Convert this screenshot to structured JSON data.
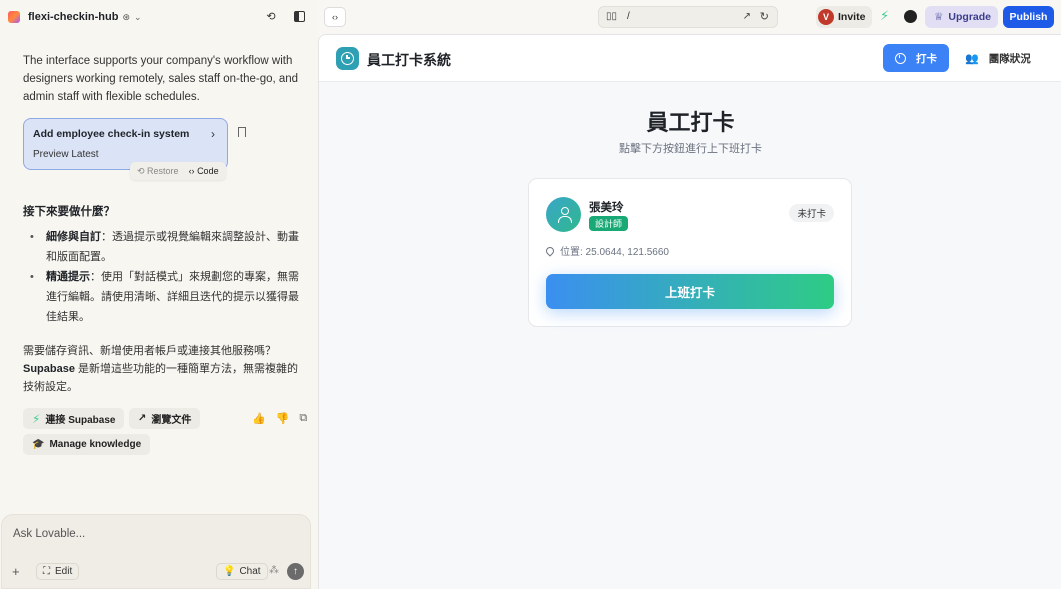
{
  "topbar": {
    "project_name": "flexi-checkin-hub",
    "url_path": "/",
    "invite_label": "Invite",
    "avatar_initial": "V",
    "upgrade_label": "Upgrade",
    "publish_label": "Publish"
  },
  "chat": {
    "intro": "The interface supports your company's workflow with designers working remotely, sales staff on-the-go, and admin staff with flexible schedules.",
    "card": {
      "title": "Add employee check-in system",
      "subtitle": "Preview Latest",
      "restore_label": "Restore",
      "code_label": "Code"
    },
    "next_heading": "接下來要做什麼？",
    "bullets": [
      {
        "bold": "細修與自訂",
        "text": "：透過提示或視覺編輯來調整設計、動畫和版面配置。"
      },
      {
        "bold": "精通提示",
        "text": "：使用「對話模式」來規劃您的專案，無需進行編輯。請使用清晰、詳細且迭代的提示以獲得最佳結果。"
      }
    ],
    "supabase_text_1": "需要儲存資訊、新增使用者帳戶或連接其他服務嗎？",
    "supabase_bold": "Supabase",
    "supabase_text_2": " 是新增這些功能的一種簡單方法，無需複雜的技術設定。",
    "chips": {
      "connect": "連接 Supabase",
      "docs": "瀏覽文件",
      "knowledge": "Manage knowledge"
    }
  },
  "composer": {
    "placeholder": "Ask Lovable...",
    "edit_label": "Edit",
    "chat_label": "Chat"
  },
  "app": {
    "title": "員工打卡系統",
    "nav_punch": "打卡",
    "nav_team": "團隊狀況",
    "heading": "員工打卡",
    "subheading": "點擊下方按鈕進行上下班打卡",
    "employee": {
      "name": "張美玲",
      "role": "設計師",
      "status": "未打卡",
      "location": "位置: 25.0644, 121.5660"
    },
    "clock_in_label": "上班打卡"
  },
  "colors": {
    "primary": "#3b82f6",
    "publish": "#1d5ae8",
    "role_badge": "#19a974",
    "card_highlight": "#dbe3f6"
  }
}
